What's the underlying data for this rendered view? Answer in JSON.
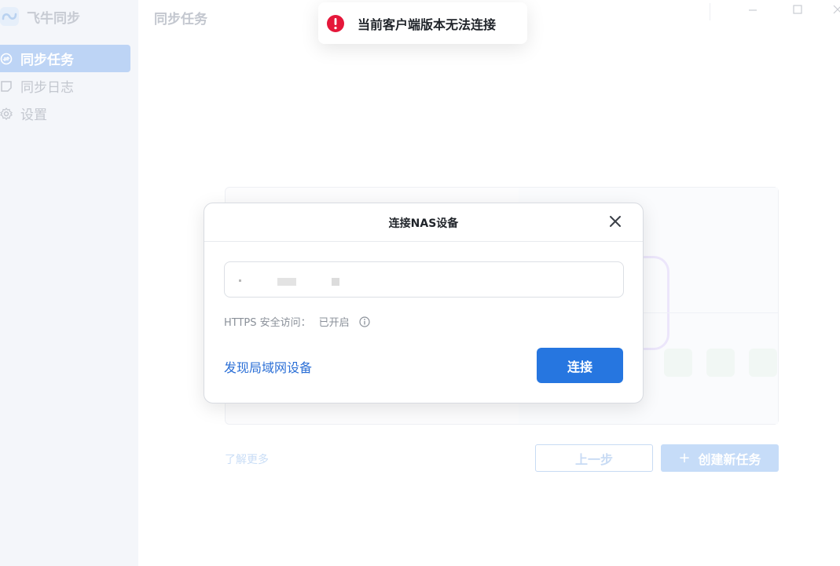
{
  "app": {
    "name": "飞牛同步"
  },
  "sidebar": {
    "items": [
      {
        "label": "同步任务",
        "icon": "sync-icon",
        "active": true
      },
      {
        "label": "同步日志",
        "icon": "log-icon",
        "active": false
      },
      {
        "label": "设置",
        "icon": "gear-icon",
        "active": false
      }
    ]
  },
  "header": {
    "title": "同步任务"
  },
  "background": {
    "learn_more": "了解更多",
    "prev_label": "上一步",
    "create_label": "创建新任务",
    "create_icon": "+"
  },
  "modal": {
    "title": "连接NAS设备",
    "address_value": "",
    "https_label": "HTTPS 安全访问：",
    "https_value": "已开启",
    "discover_link": "发现局域网设备",
    "connect_label": "连接"
  },
  "toast": {
    "message": "当前客户端版本无法连接",
    "type": "error"
  },
  "colors": {
    "accent": "#2676e0",
    "error": "#e5173a",
    "sidebar_bg": "#f4f6fa"
  }
}
